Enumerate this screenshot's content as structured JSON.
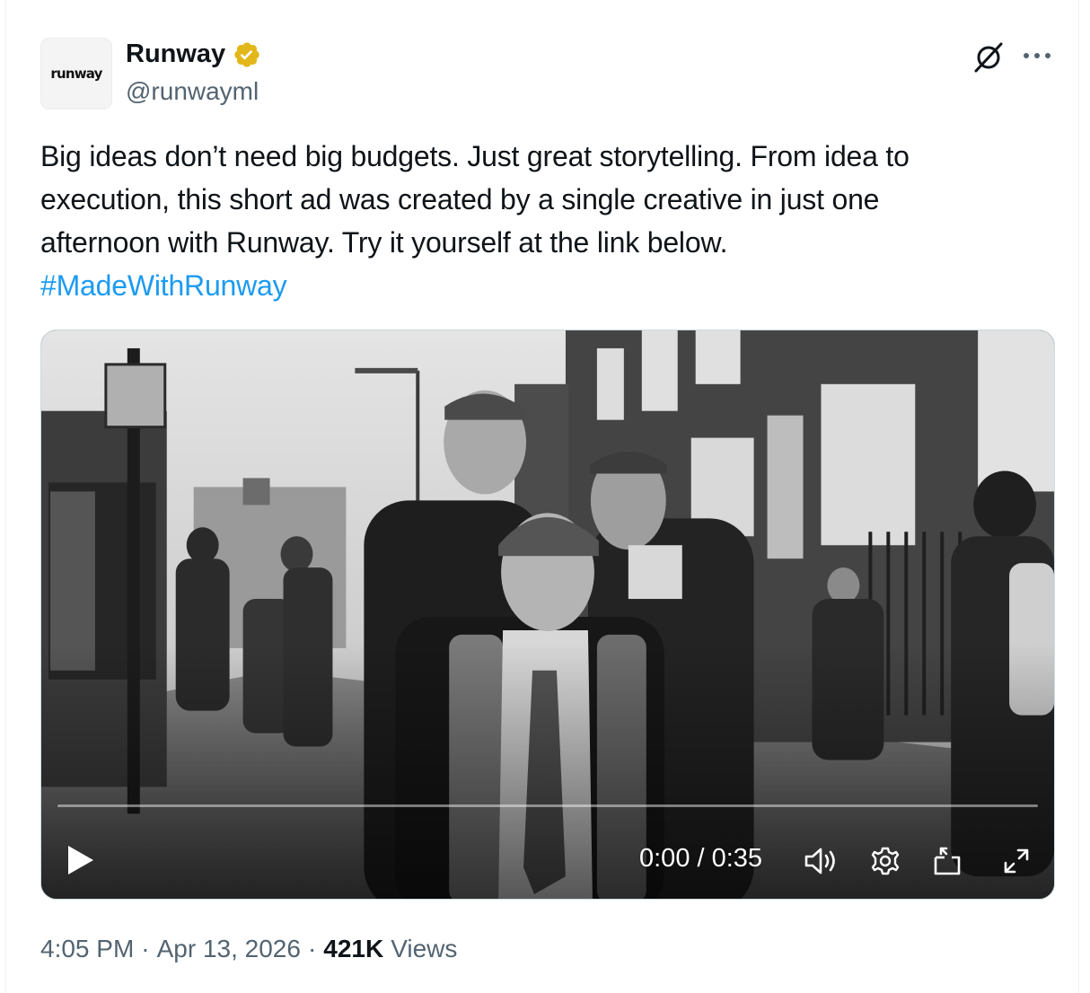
{
  "author": {
    "avatar_text": "runway",
    "display_name": "Runway",
    "handle": "@runwayml",
    "verified_icon": "gold-verified-badge-icon",
    "verified_color": "#e2b719"
  },
  "tweet": {
    "line1": "Big ideas don’t need big budgets. Just great storytelling. From idea to",
    "line2": "execution, this short ad was created by a single creative in just one",
    "line3": "afternoon with Runway. Try it yourself at the link below.",
    "hashtag": "#MadeWithRunway",
    "hashtag_color": "#1d9bf0"
  },
  "video": {
    "time": "0:00 / 0:35",
    "progress": 0,
    "controls": [
      "play-icon",
      "volume-icon",
      "settings-gear-icon",
      "picture-in-picture-icon",
      "fullscreen-expand-icon"
    ]
  },
  "meta": {
    "time": "4:05 PM",
    "date": "Apr 13, 2026",
    "views_count": "421K",
    "views_label": "Views"
  }
}
